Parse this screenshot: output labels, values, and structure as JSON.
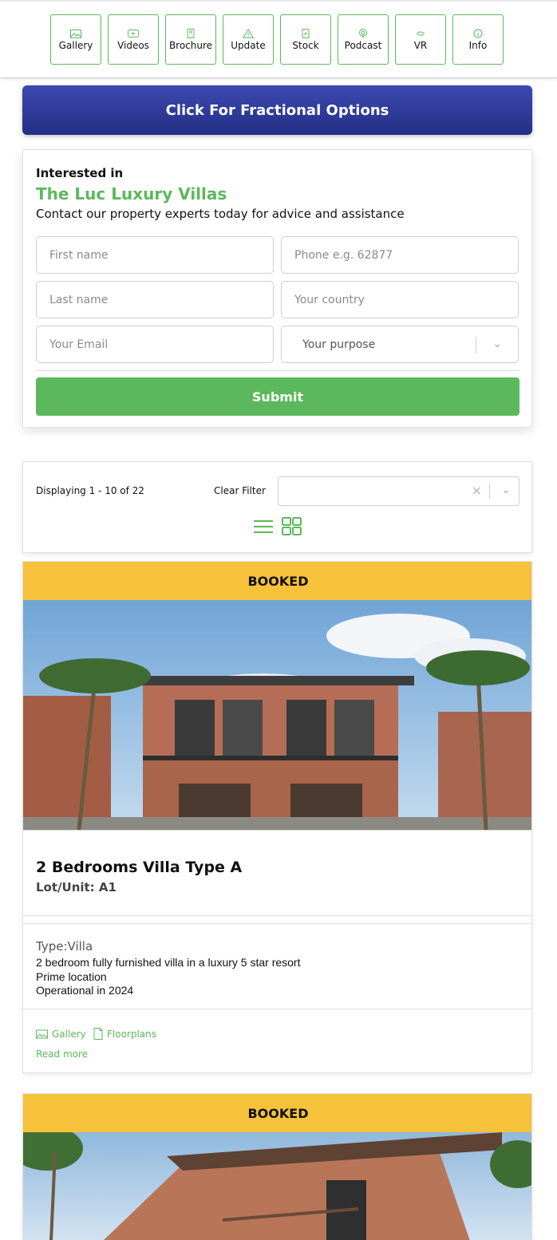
{
  "nav": {
    "items": [
      {
        "label": "Gallery",
        "icon": "gallery-icon"
      },
      {
        "label": "Videos",
        "icon": "video-icon"
      },
      {
        "label": "Brochure",
        "icon": "brochure-icon"
      },
      {
        "label": "Update",
        "icon": "update-icon"
      },
      {
        "label": "Stock",
        "icon": "stock-icon"
      },
      {
        "label": "Podcast",
        "icon": "podcast-icon"
      },
      {
        "label": "VR",
        "icon": "vr-icon"
      },
      {
        "label": "Info",
        "icon": "info-icon"
      }
    ]
  },
  "fractional": {
    "label": "Click For Fractional Options"
  },
  "form": {
    "interested": "Interested in",
    "property_name": "The Luc Luxury Villas",
    "contact_line": "Contact our property experts today for advice and assistance",
    "first_name_placeholder": "First name",
    "phone_placeholder": "Phone e.g. 62877",
    "last_name_placeholder": "Last name",
    "country_placeholder": "Your country",
    "email_placeholder": "Your Email",
    "purpose_placeholder": "Your purpose",
    "submit_label": "Submit"
  },
  "filter": {
    "displaying": "Displaying 1 - 10 of 22",
    "clear_filter": "Clear Filter",
    "clear_glyph": "×",
    "chevron_glyph": "⌄"
  },
  "listings": [
    {
      "status": "BOOKED",
      "title": "2 Bedrooms Villa Type A",
      "lot": "Lot/Unit: A1",
      "type": "Type:Villa",
      "description": [
        "2 bedroom fully furnished villa in a luxury 5 star resort",
        "Prime location",
        "Operational in 2024"
      ],
      "links": {
        "gallery": "Gallery",
        "floorplans": "Floorplans",
        "read_more": "Read more"
      }
    },
    {
      "status": "BOOKED"
    }
  ],
  "colors": {
    "accent_green": "#5cb85c",
    "banner_blue": "#2a3590",
    "booked_yellow": "#f7c23b"
  }
}
